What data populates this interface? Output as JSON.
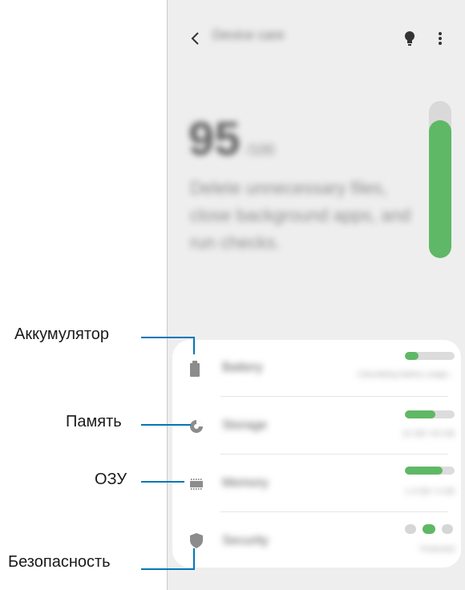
{
  "appbar": {
    "title": "Device care",
    "icons": [
      "chevron-left-icon",
      "lightbulb-icon",
      "more-vert-icon"
    ]
  },
  "summary": {
    "score": "95",
    "unit": "/100",
    "description": "Delete unnecessary files, close background apps, and run checks.",
    "score_fraction": 0.88
  },
  "items": [
    {
      "label": "Battery",
      "sub": "Calculating battery usage...",
      "fill": 0.28,
      "icon": "battery-icon"
    },
    {
      "label": "Storage",
      "sub": "22 GB / 64 GB",
      "fill": 0.62,
      "icon": "pie-chart-icon"
    },
    {
      "label": "Memory",
      "sub": "1.3 GB / 4 GB",
      "fill": 0.75,
      "icon": "memory-chip-icon"
    },
    {
      "label": "Security",
      "sub": "Protected",
      "icon": "shield-icon"
    }
  ],
  "callouts": [
    {
      "text": "Аккумулятор"
    },
    {
      "text": "Память"
    },
    {
      "text": "ОЗУ"
    },
    {
      "text": "Безопасность"
    }
  ],
  "colors": {
    "accent": "#5fb865",
    "leader": "#0077b6",
    "screen_bg": "#eeeeee",
    "card_bg": "#ffffff"
  }
}
